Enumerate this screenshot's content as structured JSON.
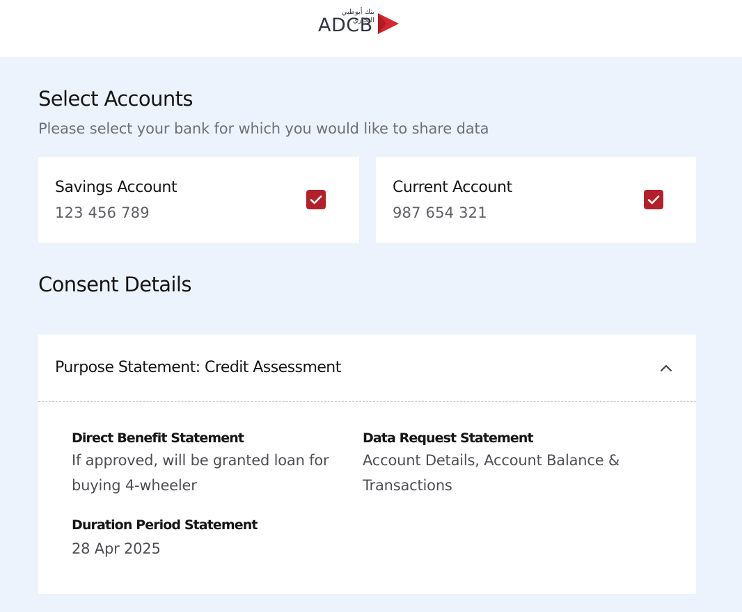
{
  "header": {
    "logo": {
      "arabic_text": "بنك أبوظبي التجاري",
      "wordmark": "ADCB",
      "brand_color": "#d7262f",
      "icon": "adcb-arrow-logo-icon"
    }
  },
  "select_accounts": {
    "title": "Select Accounts",
    "subtitle": "Please select your bank for which you would like to share data",
    "accounts": [
      {
        "name": "Savings Account",
        "number": "123 456 789",
        "checked": true
      },
      {
        "name": "Current Account",
        "number": "987 654 321",
        "checked": true
      }
    ],
    "checkbox_color": "#b3202a"
  },
  "consent_details": {
    "title": "Consent Details",
    "purpose_statement": "Purpose Statement: Credit Assessment",
    "expanded": true,
    "toggle_icon": "chevron-up-icon",
    "direct_benefit": {
      "label": "Direct Benefit Statement",
      "value": "If approved, will be granted loan for buying 4-wheeler"
    },
    "data_request": {
      "label": "Data Request Statement",
      "value": "Account Details, Account Balance & Transactions"
    },
    "duration_period": {
      "label": "Duration Period Statement",
      "value": "28 Apr 2025"
    }
  }
}
